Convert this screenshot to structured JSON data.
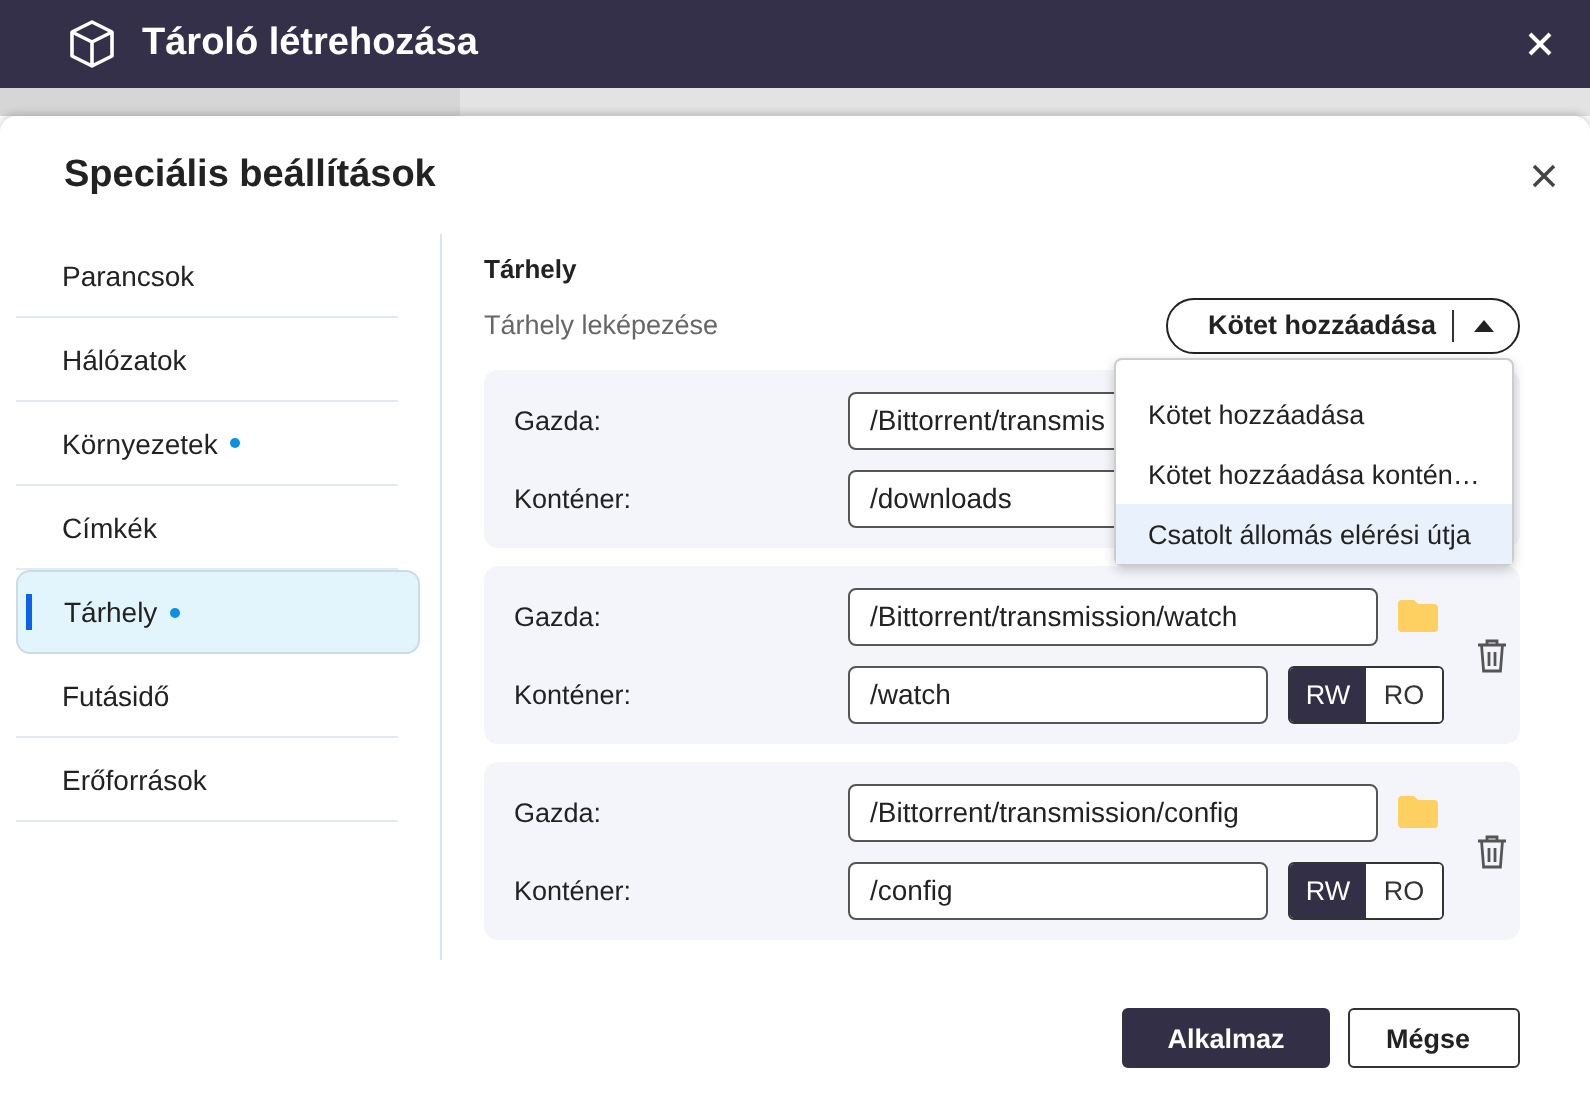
{
  "window": {
    "title": "Tároló létrehozása"
  },
  "dialog": {
    "title": "Speciális beállítások",
    "sidebar": {
      "items": [
        {
          "label": "Parancsok",
          "selected": false,
          "modified": false
        },
        {
          "label": "Hálózatok",
          "selected": false,
          "modified": false
        },
        {
          "label": "Környezetek",
          "selected": false,
          "modified": true
        },
        {
          "label": "Címkék",
          "selected": false,
          "modified": false
        },
        {
          "label": "Tárhely",
          "selected": true,
          "modified": true
        },
        {
          "label": "Futásidő",
          "selected": false,
          "modified": false
        },
        {
          "label": "Erőforrások",
          "selected": false,
          "modified": false
        }
      ]
    },
    "section_title": "Tárhely",
    "mapping_label": "Tárhely leképezése",
    "add_button": {
      "label": "Kötet hozzáadása",
      "expanded": true
    },
    "add_menu": [
      {
        "label": "Kötet hozzáadása",
        "selected": false
      },
      {
        "label": "Kötet hozzáadása kontén…",
        "selected": false
      },
      {
        "label": "Csatolt állomás elérési útja",
        "selected": true
      }
    ],
    "volumes": [
      {
        "kind": "covered",
        "host_label": "Gazda:",
        "host": "/Bittorrent/transmis",
        "container_label": "Konténer:",
        "container": "/downloads"
      },
      {
        "kind": "full",
        "host_label": "Gazda:",
        "host": "/Bittorrent/transmission/watch",
        "container_label": "Konténer:",
        "container": "/watch",
        "modes": [
          {
            "label": "RW",
            "selected": true
          },
          {
            "label": "RO",
            "selected": false
          }
        ]
      },
      {
        "kind": "full",
        "host_label": "Gazda:",
        "host": "/Bittorrent/transmission/config",
        "container_label": "Konténer:",
        "container": "/config",
        "modes": [
          {
            "label": "RW",
            "selected": true
          },
          {
            "label": "RO",
            "selected": false
          }
        ]
      }
    ],
    "buttons": [
      {
        "label": "Alkalmaz",
        "kind": "primary"
      },
      {
        "label": "Mégse",
        "kind": "secondary"
      }
    ]
  }
}
